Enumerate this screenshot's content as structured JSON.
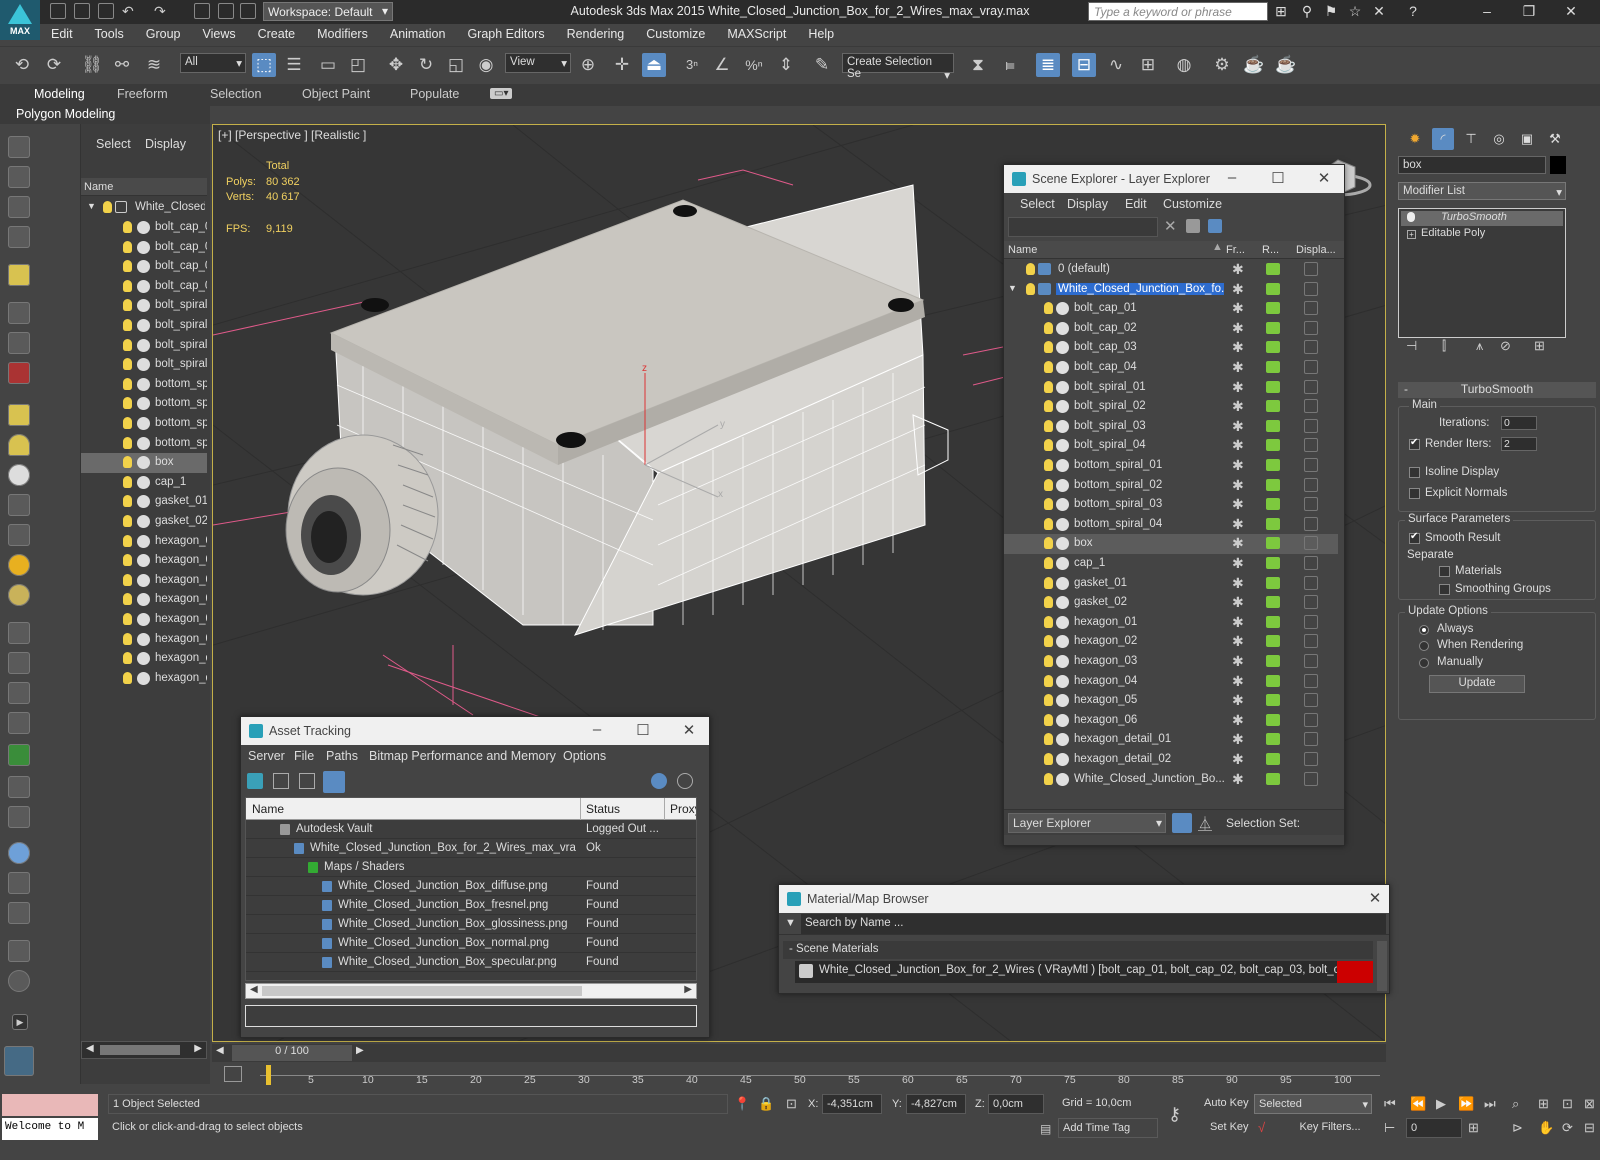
{
  "app": {
    "logo_text": "MAX",
    "title": "Autodesk 3ds Max  2015     White_Closed_Junction_Box_for_2_Wires_max_vray.max",
    "workspace": "Workspace: Default",
    "search_placeholder": "Type a keyword or phrase"
  },
  "menu": [
    "Edit",
    "Tools",
    "Group",
    "Views",
    "Create",
    "Modifiers",
    "Animation",
    "Graph Editors",
    "Rendering",
    "Customize",
    "MAXScript",
    "Help"
  ],
  "toolbar": {
    "filter": "All",
    "ref_coord": "View",
    "selection_set": "Create Selection Se",
    "snap_3": "3",
    "snap_pct": "%"
  },
  "ribbon": {
    "tabs": [
      "Modeling",
      "Freeform",
      "Selection",
      "Object Paint",
      "Populate"
    ],
    "sub": "Polygon Modeling"
  },
  "left_explorer": {
    "tabs": [
      "Select",
      "Display"
    ],
    "column": "Name",
    "root": "White_Closed_",
    "items": [
      "bolt_cap_0",
      "bolt_cap_0",
      "bolt_cap_0",
      "bolt_cap_0",
      "bolt_spiral.",
      "bolt_spiral.",
      "bolt_spiral.",
      "bolt_spiral.",
      "bottom_spi",
      "bottom_spi",
      "bottom_spi",
      "bottom_spi",
      "box",
      "cap_1",
      "gasket_01",
      "gasket_02",
      "hexagon_0",
      "hexagon_0",
      "hexagon_0",
      "hexagon_0",
      "hexagon_0",
      "hexagon_0",
      "hexagon_d",
      "hexagon_d"
    ],
    "selected_index": 12
  },
  "viewport": {
    "label": "[+] [Perspective ] [Realistic ]",
    "stats": {
      "total_label": "Total",
      "polys_label": "Polys:",
      "polys": "80 362",
      "verts_label": "Verts:",
      "verts": "40 617",
      "fps_label": "FPS:",
      "fps": "9,119"
    },
    "axis_z": "z",
    "axis_y": "y",
    "axis_x": "x"
  },
  "scene_explorer": {
    "title": "Scene Explorer - Layer Explorer",
    "menu": [
      "Select",
      "Display",
      "Edit",
      "Customize"
    ],
    "columns": [
      "Name",
      "Fr...",
      "R...",
      "Displa..."
    ],
    "layers": [
      {
        "name": "0 (default)",
        "level": 0
      },
      {
        "name": "White_Closed_Junction_Box_fo...",
        "level": 0,
        "highlight": true
      }
    ],
    "objects": [
      "bolt_cap_01",
      "bolt_cap_02",
      "bolt_cap_03",
      "bolt_cap_04",
      "bolt_spiral_01",
      "bolt_spiral_02",
      "bolt_spiral_03",
      "bolt_spiral_04",
      "bottom_spiral_01",
      "bottom_spiral_02",
      "bottom_spiral_03",
      "bottom_spiral_04",
      "box",
      "cap_1",
      "gasket_01",
      "gasket_02",
      "hexagon_01",
      "hexagon_02",
      "hexagon_03",
      "hexagon_04",
      "hexagon_05",
      "hexagon_06",
      "hexagon_detail_01",
      "hexagon_detail_02",
      "White_Closed_Junction_Bo..."
    ],
    "selected_object": "box",
    "footer_dropdown": "Layer Explorer",
    "footer_label": "Selection Set:"
  },
  "right_panel": {
    "name_field": "box",
    "modifier_list": "Modifier List",
    "stack": [
      "TurboSmooth",
      "Editable Poly"
    ],
    "rollout_title": "TurboSmooth",
    "main_label": "Main",
    "iterations_label": "Iterations:",
    "iterations": "0",
    "render_iters_label": "Render Iters:",
    "render_iters": "2",
    "isoline": "Isoline Display",
    "explicit_normals": "Explicit Normals",
    "surface_params": "Surface Parameters",
    "smooth_result": "Smooth Result",
    "separate": "Separate",
    "materials": "Materials",
    "smoothing_groups": "Smoothing Groups",
    "update_options": "Update Options",
    "always": "Always",
    "when_rendering": "When Rendering",
    "manually": "Manually",
    "update_button": "Update"
  },
  "asset_tracking": {
    "title": "Asset Tracking",
    "menu": [
      "Server",
      "File",
      "Paths",
      "Bitmap Performance and Memory",
      "Options"
    ],
    "columns": [
      "Name",
      "Status",
      "Proxy"
    ],
    "rows": [
      {
        "name": "Autodesk Vault",
        "status": "Logged Out ...",
        "indent": 1
      },
      {
        "name": "White_Closed_Junction_Box_for_2_Wires_max_vray....",
        "status": "Ok",
        "indent": 2
      },
      {
        "name": "Maps / Shaders",
        "status": "",
        "indent": 3
      },
      {
        "name": "White_Closed_Junction_Box_diffuse.png",
        "status": "Found",
        "indent": 4
      },
      {
        "name": "White_Closed_Junction_Box_fresnel.png",
        "status": "Found",
        "indent": 4
      },
      {
        "name": "White_Closed_Junction_Box_glossiness.png",
        "status": "Found",
        "indent": 4
      },
      {
        "name": "White_Closed_Junction_Box_normal.png",
        "status": "Found",
        "indent": 4
      },
      {
        "name": "White_Closed_Junction_Box_specular.png",
        "status": "Found",
        "indent": 4
      }
    ]
  },
  "material_browser": {
    "title": "Material/Map Browser",
    "search_placeholder": "Search by Name ...",
    "section": "Scene Materials",
    "entry": "White_Closed_Junction_Box_for_2_Wires ( VRayMtl ) [bolt_cap_01, bolt_cap_02, bolt_cap_03, bolt_cap_0..."
  },
  "timeline": {
    "frame": "0 / 100",
    "ticks": [
      "5",
      "10",
      "15",
      "20",
      "25",
      "30",
      "35",
      "40",
      "45",
      "50",
      "55",
      "60",
      "65",
      "70",
      "75",
      "80",
      "85",
      "90",
      "95",
      "100"
    ]
  },
  "status": {
    "maxscript": "Welcome to M",
    "objects_selected": "1 Object Selected",
    "prompt": "Click or click-and-drag to select objects",
    "x_label": "X:",
    "x": "-4,351cm",
    "y_label": "Y:",
    "y": "-4,827cm",
    "z_label": "Z:",
    "z": "0,0cm",
    "grid": "Grid = 10,0cm",
    "add_time_tag": "Add Time Tag",
    "auto_key": "Auto Key",
    "set_key": "Set Key",
    "selected": "Selected",
    "key_filters": "Key Filters...",
    "frame_field": "0"
  },
  "colors": {
    "accent": "#5a8bc2",
    "selection": "#2d6ccf",
    "viewport_border": "#c4b049",
    "stats_text": "#f0d060",
    "bulb": "#f2d24a"
  }
}
